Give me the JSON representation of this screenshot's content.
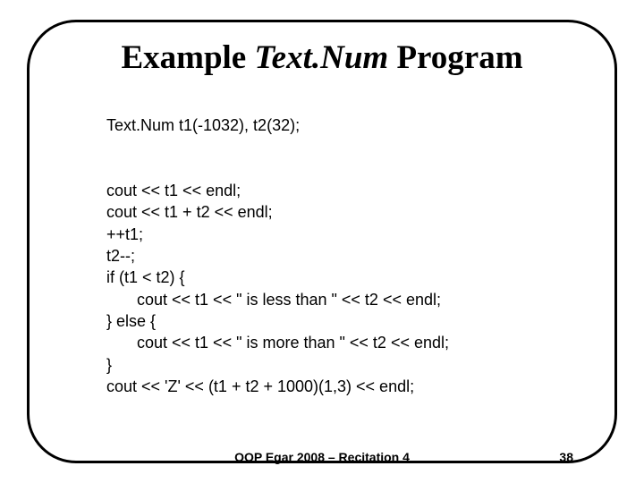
{
  "title": {
    "pre": "Example ",
    "ital": "Text.Num",
    "post": " Program"
  },
  "code": {
    "l1": "Text.Num t1(-1032), t2(32);",
    "l2": "cout << t1 << endl;",
    "l3": "cout << t1 + t2 << endl;",
    "l4": "++t1;",
    "l5": "t2--;",
    "l6": "if (t1 < t2) {",
    "l7": "cout << t1 << \" is less than \" << t2 << endl;",
    "l8": "} else {",
    "l9": "cout << t1 << \" is more than \" << t2 << endl;",
    "l10": "}",
    "l11": "cout << 'Z' << (t1 + t2 + 1000)(1,3) << endl;"
  },
  "footer": {
    "center": "OOP Egar 2008 – Recitation 4",
    "page": "38"
  }
}
